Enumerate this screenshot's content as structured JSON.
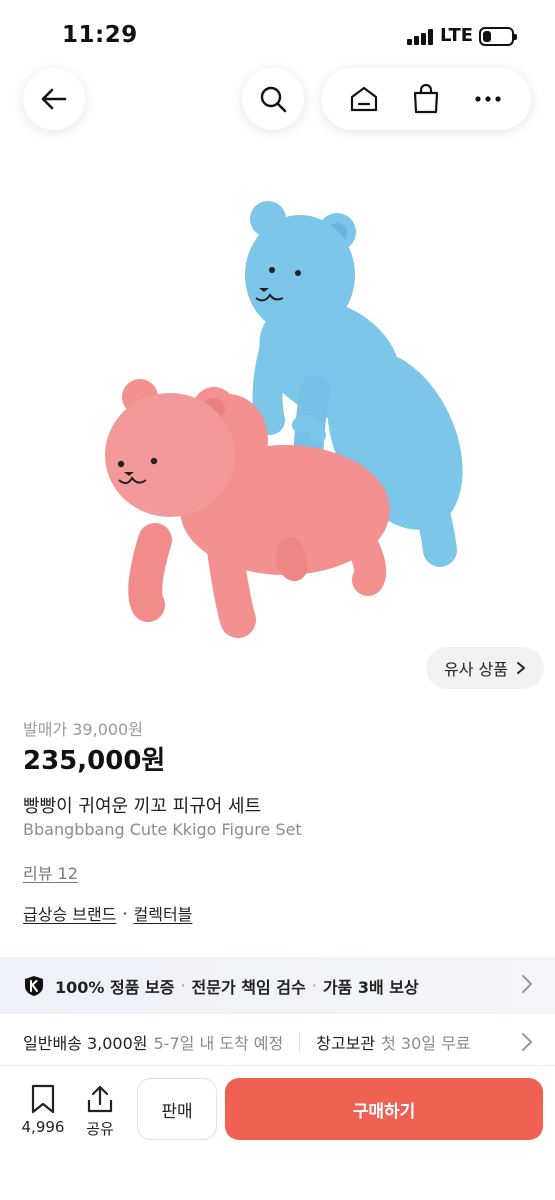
{
  "status_bar": {
    "time": "11:29",
    "network": "LTE",
    "battery_level": 0.3
  },
  "top_bar": {
    "icons": [
      "back-arrow-icon",
      "search-icon",
      "home-icon",
      "shopping-bag-icon",
      "more-icon"
    ]
  },
  "product": {
    "similar_button_label": "유사 상품",
    "release_price": "발매가 39,000원",
    "price": "235,000원",
    "title_ko": "빵빵이 귀여운 끼꼬 피규어 세트",
    "title_en": "Bbangbbang Cute Kkigo Figure Set",
    "review_link": "리뷰 12",
    "tags": [
      "급상승 브랜드",
      "컬렉터블"
    ],
    "tag_separator": "·"
  },
  "guarantee": {
    "item1": "100% 정품 보증",
    "item2": "전문가 책임 검수",
    "item3": "가품 3배 보상",
    "separator": "·"
  },
  "shipping": {
    "standard_label": "일반배송 3,000원",
    "standard_eta": "5-7일 내 도착 예정",
    "warehouse_label": "창고보관",
    "warehouse_note": "첫 30일 무료"
  },
  "bottom_bar": {
    "bookmark_count": "4,996",
    "share_label": "공유",
    "sell_label": "판매",
    "buy_label": "구매하기"
  },
  "colors": {
    "accent": "#ef6253",
    "blue_bear": "#7cc6ea",
    "pink_bear": "#f2918f"
  }
}
